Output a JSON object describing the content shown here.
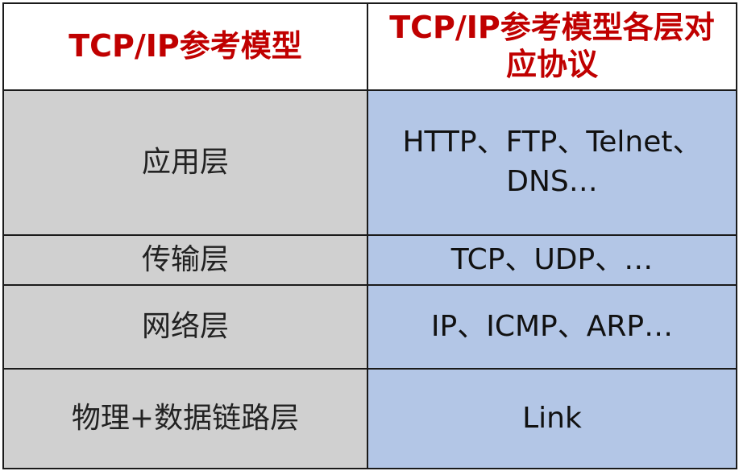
{
  "header": {
    "col1": "TCP/IP参考模型",
    "col2": "TCP/IP参考模型各层对应协议"
  },
  "rows": [
    {
      "layer": "应用层",
      "protocols": "HTTP、FTP、Telnet、DNS…"
    },
    {
      "layer": "传输层",
      "protocols": "TCP、UDP、…"
    },
    {
      "layer": "网络层",
      "protocols": "IP、ICMP、ARP…"
    },
    {
      "layer": "物理+数据链路层",
      "protocols": "Link"
    }
  ],
  "colors": {
    "header_text": "#c00000",
    "layer_bg": "#d0d0d0",
    "protocol_bg": "#b3c6e6"
  }
}
